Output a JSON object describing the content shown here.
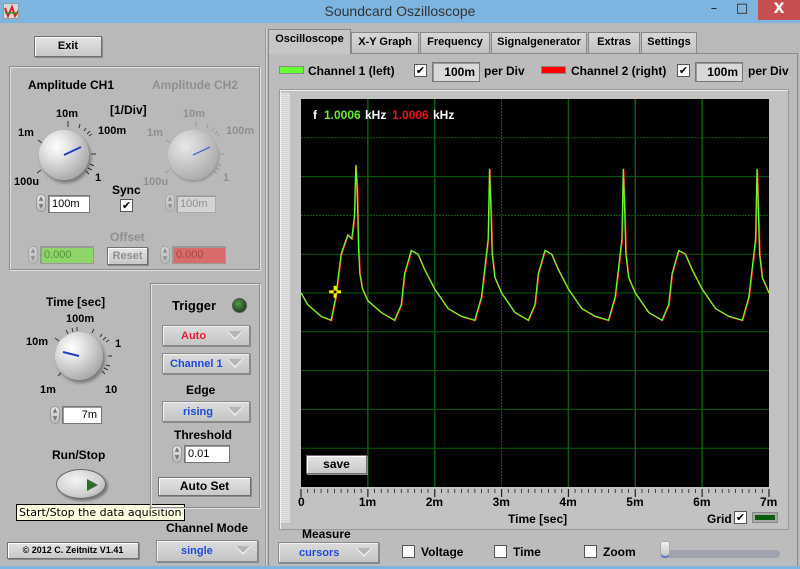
{
  "window": {
    "title": "Soundcard Oszilloscope",
    "minimize_label": "–",
    "maximize_label": "□",
    "close_label": "X"
  },
  "left": {
    "exit_label": "Exit",
    "amplitude": {
      "ch1_title": "Amplitude CH1",
      "ch2_title": "Amplitude CH2",
      "unit_label": "[1/Div]",
      "scale_labels": [
        "100u",
        "1m",
        "10m",
        "100m",
        "1"
      ],
      "ch1_value": "100m",
      "ch2_value": "100m",
      "sync_label": "Sync",
      "sync_checked": "✔",
      "offset_label": "Offset",
      "offset_ch1": "0.000",
      "offset_ch2": "0.000",
      "reset_label": "Reset"
    },
    "time": {
      "title": "Time [sec]",
      "scale_labels": [
        "1m",
        "10m",
        "100m",
        "1",
        "10"
      ],
      "value": "7m"
    },
    "trigger": {
      "title": "Trigger",
      "mode": "Auto",
      "channel": "Channel 1",
      "edge_label": "Edge",
      "edge": "rising",
      "threshold_label": "Threshold",
      "threshold": "0.01",
      "autoset_label": "Auto Set"
    },
    "run_stop_label": "Run/Stop",
    "tooltip": "Start/Stop the data aquisition",
    "channel_mode_label": "Channel Mode",
    "channel_mode": "single",
    "copyright": "© 2012  C. Zeitnitz V1.41"
  },
  "tabs": [
    {
      "label": "Oscilloscope",
      "active": true
    },
    {
      "label": "X-Y Graph",
      "active": false
    },
    {
      "label": "Frequency",
      "active": false
    },
    {
      "label": "Signalgenerator",
      "active": false
    },
    {
      "label": "Extras",
      "active": false
    },
    {
      "label": "Settings",
      "active": false
    }
  ],
  "channels": {
    "ch1_label": "Channel 1 (left)",
    "ch1_color": "#66ff33",
    "ch1_enabled": "✔",
    "ch1_scale": "100m",
    "ch2_label": "Channel 2 (right)",
    "ch2_color": "#ff0000",
    "ch2_enabled": "✔",
    "ch2_scale": "100m",
    "per_div_label": "per Div"
  },
  "graph": {
    "freq_prefix": "f",
    "freq_ch1": "1.0006",
    "freq_ch2": "1.0006",
    "freq_unit": "kHz",
    "save_label": "save",
    "grid_label": "Grid",
    "grid_checked": "✔",
    "grid_color": "#0b5d0b"
  },
  "measure": {
    "label": "Measure",
    "mode": "cursors",
    "voltage_label": "Voltage",
    "time_label": "Time",
    "zoom_label": "Zoom",
    "slider_value": 0
  },
  "chart_data": {
    "type": "line",
    "title": "",
    "xlabel": "Time [sec]",
    "ylabel": "",
    "x_tick_labels": [
      "0",
      "1m",
      "2m",
      "3m",
      "4m",
      "5m",
      "6m",
      "7m"
    ],
    "xlim": [
      0,
      7
    ],
    "x_unit": "ms",
    "ylim": [
      -0.5,
      0.5
    ],
    "y_unit": "V",
    "y_divisions": 10,
    "grid": true,
    "cursor": {
      "x": 0.51,
      "y": 0.003
    },
    "series": [
      {
        "name": "Channel 1 (left)",
        "color": "#66ff33",
        "x": [
          0,
          0.1,
          0.3,
          0.45,
          0.52,
          0.6,
          0.7,
          0.76,
          0.8,
          0.82,
          0.84,
          0.86,
          0.88,
          0.92,
          1.0,
          1.2,
          1.4,
          1.5,
          1.55,
          1.65,
          1.75,
          1.85,
          2.0,
          2.2,
          2.4,
          2.6,
          2.7,
          2.78,
          2.8,
          2.82,
          2.84,
          2.86,
          2.9,
          3.0,
          3.2,
          3.4,
          3.5,
          3.55,
          3.65,
          3.75,
          3.85,
          4.0,
          4.2,
          4.4,
          4.6,
          4.7,
          4.78,
          4.8,
          4.82,
          4.84,
          4.86,
          4.9,
          5.0,
          5.2,
          5.4,
          5.5,
          5.55,
          5.65,
          5.75,
          5.85,
          6.0,
          6.2,
          6.4,
          6.6,
          6.7,
          6.78,
          6.8,
          6.82,
          6.84,
          6.86,
          6.9,
          7.0
        ],
        "y": [
          0.0,
          -0.03,
          -0.06,
          -0.07,
          -0.01,
          0.1,
          0.15,
          0.14,
          0.2,
          0.33,
          0.27,
          0.12,
          0.05,
          0.01,
          -0.02,
          -0.05,
          -0.07,
          -0.03,
          0.05,
          0.11,
          0.1,
          0.06,
          0.01,
          -0.04,
          -0.06,
          -0.07,
          -0.01,
          0.11,
          0.14,
          0.32,
          0.22,
          0.1,
          0.04,
          0.0,
          -0.05,
          -0.07,
          -0.03,
          0.05,
          0.11,
          0.1,
          0.06,
          0.01,
          -0.04,
          -0.06,
          -0.07,
          -0.01,
          0.11,
          0.14,
          0.32,
          0.22,
          0.1,
          0.04,
          0.0,
          -0.05,
          -0.07,
          -0.03,
          0.05,
          0.11,
          0.1,
          0.06,
          0.01,
          -0.04,
          -0.06,
          -0.07,
          -0.01,
          0.11,
          0.14,
          0.32,
          0.22,
          0.1,
          0.04,
          0.0
        ]
      }
    ]
  }
}
